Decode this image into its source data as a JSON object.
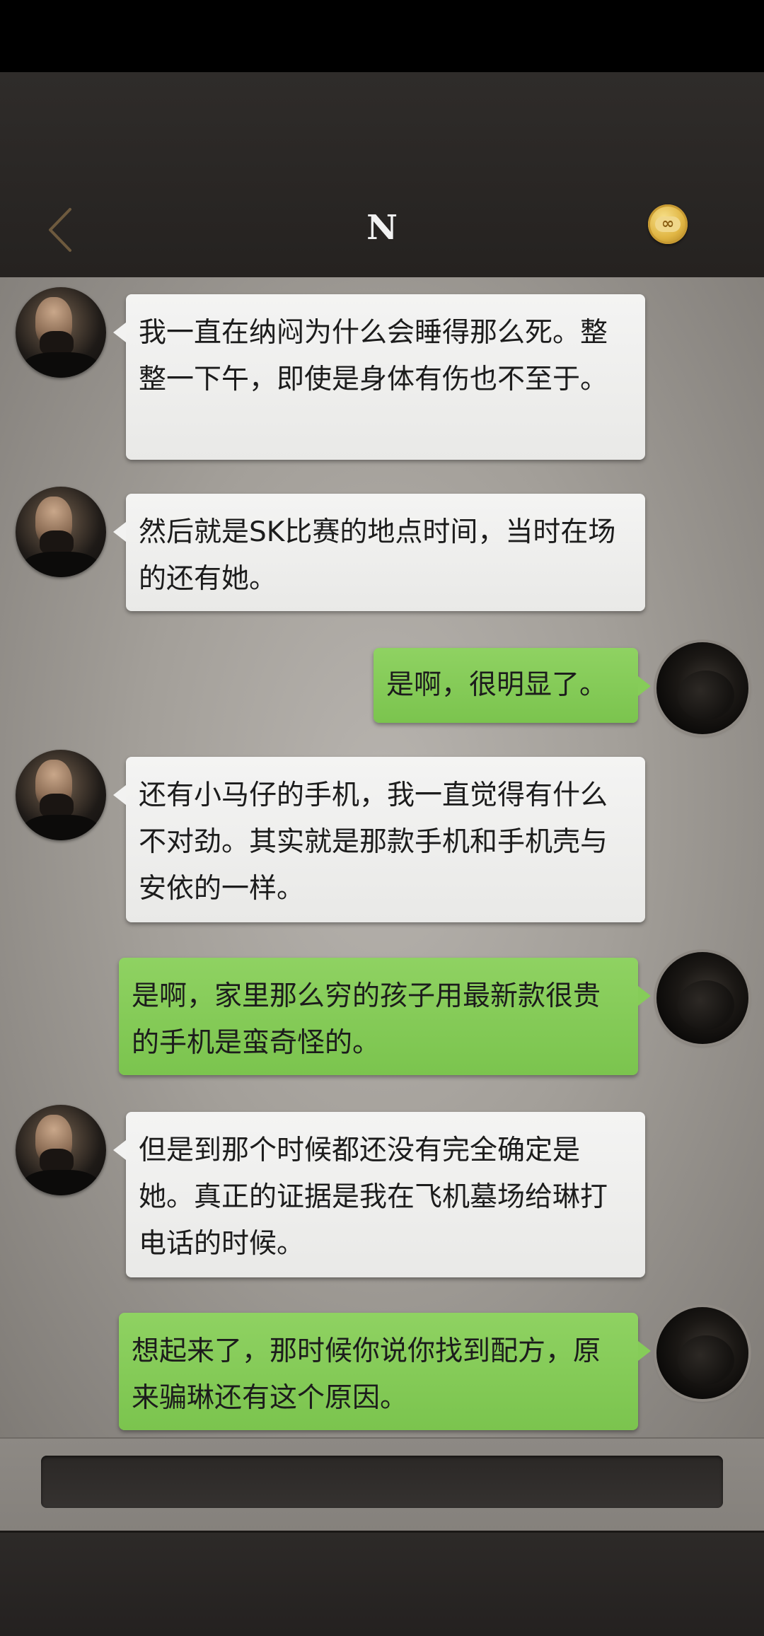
{
  "header": {
    "title": "N",
    "back_icon": "chevron-left-icon",
    "badge_icon": "infinity-icon",
    "badge_symbol": "∞",
    "colors": {
      "back": "#6e5a3e",
      "badge": "#e0b543",
      "title": "#f2f2f2"
    }
  },
  "messages": [
    {
      "side": "left",
      "text": "我一直在纳闷为什么会睡得那么死。整整一下午，即使是身体有伤也不至于。"
    },
    {
      "side": "left",
      "text": "然后就是SK比赛的地点时间，当时在场的还有她。"
    },
    {
      "side": "right",
      "text": "是啊，很明显了。"
    },
    {
      "side": "left",
      "text": "还有小马仔的手机，我一直觉得有什么不对劲。其实就是那款手机和手机壳与安依的一样。"
    },
    {
      "side": "right",
      "text": "是啊，家里那么穷的孩子用最新款很贵的手机是蛮奇怪的。"
    },
    {
      "side": "left",
      "text": "但是到那个时候都还没有完全确定是她。真正的证据是我在飞机墓场给琳打电话的时候。"
    },
    {
      "side": "right",
      "text": "想起来了，那时候你说你找到配方，原来骗琳还有这个原因。"
    }
  ],
  "colors": {
    "left_bubble": "#eeeeed",
    "right_bubble": "#85cb57",
    "chat_background": "#a39f99"
  }
}
